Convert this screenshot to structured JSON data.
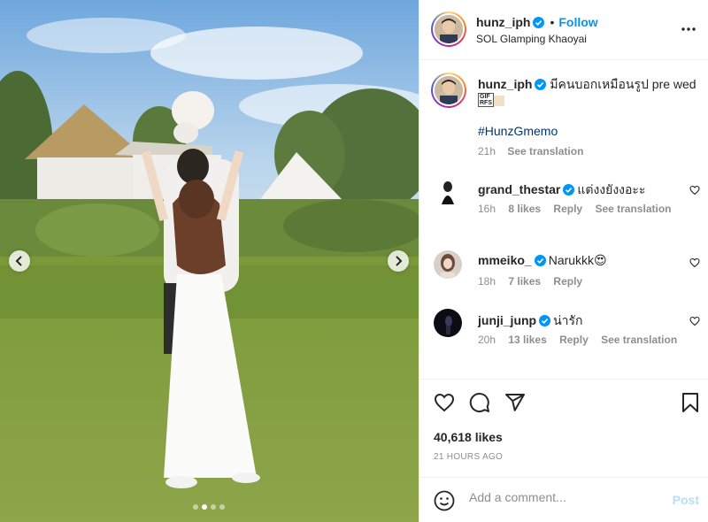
{
  "post": {
    "username": "hunz_iph",
    "follow_label": "Follow",
    "bullet": "•",
    "location": "SOL Glamping Khaoyai",
    "more_icon": "more-horizontal-icon",
    "verified_color": "#0095f6"
  },
  "caption": {
    "username": "hunz_iph",
    "text": "มีคนบอกเหมือนรูป pre wed",
    "gif_top": "GIF",
    "gif_bottom": "RFS",
    "hashtag": "#HunzGmemo",
    "time": "21h",
    "see_translation": "See translation"
  },
  "comments": [
    {
      "username": "grand_thestar",
      "text": "แต่งงยังงอะะ",
      "time": "16h",
      "likes": "8 likes",
      "reply": "Reply",
      "see_translation": "See translation"
    },
    {
      "username": "mmeiko_",
      "text": "Narukkk😍",
      "time": "18h",
      "likes": "7 likes",
      "reply": "Reply"
    },
    {
      "username": "junji_junp",
      "text": "น่ารัก",
      "time": "20h",
      "likes": "13 likes",
      "reply": "Reply",
      "see_translation": "See translation"
    }
  ],
  "stats": {
    "likes": "40,618 likes",
    "time_ago": "21 HOURS AGO"
  },
  "add_comment": {
    "placeholder": "Add a comment...",
    "post_label": "Post"
  },
  "carousel": {
    "slide_count": 4,
    "active_index": 1
  },
  "colors": {
    "accent": "#0095f6",
    "hashtag": "#00376b",
    "muted": "#8e8e8e",
    "post_disabled": "#b2dffc"
  }
}
